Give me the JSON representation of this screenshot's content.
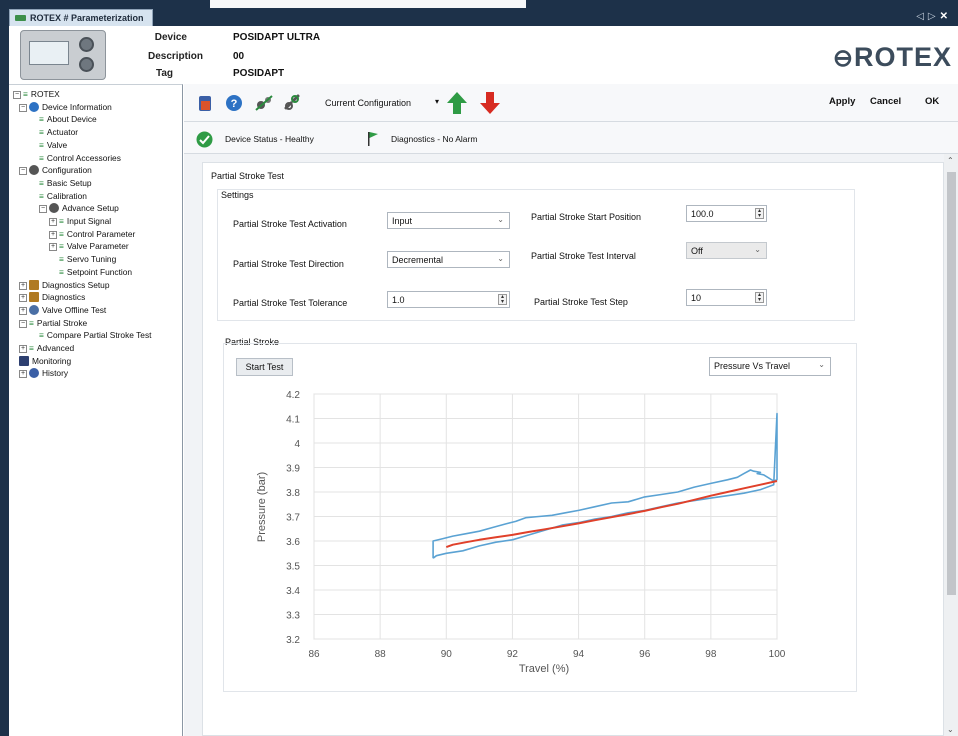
{
  "window": {
    "tab_title": "ROTEX # Parameterization",
    "controls": [
      "◁",
      "▷",
      "✕"
    ]
  },
  "header": {
    "device_label": "Device",
    "device_value": "POSIDAPT ULTRA",
    "description_label": "Description",
    "description_value": "00",
    "tag_label": "Tag",
    "tag_value": "POSIDAPT",
    "logo_text": "ROTEX"
  },
  "tree": [
    {
      "label": "ROTEX",
      "expander": "−",
      "icon": "eq"
    },
    {
      "label": "Device Information",
      "expander": "−",
      "icon": "info"
    },
    {
      "label": "About Device",
      "icon": "eq"
    },
    {
      "label": "Actuator",
      "icon": "eq"
    },
    {
      "label": "Valve",
      "icon": "eq"
    },
    {
      "label": "Control Accessories",
      "icon": "eq"
    },
    {
      "label": "Configuration",
      "expander": "−",
      "icon": "gear"
    },
    {
      "label": "Basic Setup",
      "icon": "eq"
    },
    {
      "label": "Calibration",
      "icon": "eq"
    },
    {
      "label": "Advance Setup",
      "expander": "−",
      "icon": "gear"
    },
    {
      "label": "Input Signal",
      "expander": "+",
      "icon": "eq"
    },
    {
      "label": "Control Parameter",
      "expander": "+",
      "icon": "eq"
    },
    {
      "label": "Valve Parameter",
      "expander": "+",
      "icon": "eq"
    },
    {
      "label": "Servo Tuning",
      "icon": "eq"
    },
    {
      "label": "Setpoint Function",
      "icon": "eq"
    },
    {
      "label": "Diagnostics Setup",
      "expander": "+",
      "icon": "bars"
    },
    {
      "label": "Diagnostics",
      "expander": "+",
      "icon": "bars"
    },
    {
      "label": "Valve Offline Test",
      "expander": "+",
      "icon": "clock"
    },
    {
      "label": "Partial Stroke",
      "expander": "−",
      "icon": "eq"
    },
    {
      "label": "Compare Partial Stroke Test",
      "icon": "eq"
    },
    {
      "label": "Advanced",
      "expander": "+",
      "icon": "eq"
    },
    {
      "label": "Monitoring",
      "icon": "screen"
    },
    {
      "label": "History",
      "expander": "+",
      "icon": "history"
    }
  ],
  "toolbar": {
    "config_select": "Current Configuration",
    "apply": "Apply",
    "cancel": "Cancel",
    "ok": "OK"
  },
  "status": {
    "device_status": "Device Status - Healthy",
    "diagnostics": "Diagnostics - No Alarm"
  },
  "partial_stroke_test": {
    "title": "Partial Stroke Test",
    "settings_title": "Settings",
    "activation_label": "Partial Stroke Test Activation",
    "activation_value": "Input",
    "direction_label": "Partial Stroke Test Direction",
    "direction_value": "Decremental",
    "tolerance_label": "Partial Stroke Test Tolerance",
    "tolerance_value": "1.0",
    "start_position_label": "Partial Stroke Start Position",
    "start_position_value": "100.0",
    "interval_label": "Partial Stroke Test Interval",
    "interval_value": "Off",
    "step_label": "Partial Stroke Test Step",
    "step_value": "10"
  },
  "partial_stroke": {
    "title": "Partial Stroke",
    "start_button": "Start Test",
    "plot_select": "Pressure Vs Travel"
  },
  "chart_data": {
    "type": "line",
    "title": "",
    "xlabel": "Travel (%)",
    "ylabel": "Pressure (bar)",
    "xlim": [
      86,
      100
    ],
    "ylim": [
      3.2,
      4.2
    ],
    "xticks": [
      "86",
      "88",
      "90",
      "92",
      "94",
      "96",
      "98",
      "100"
    ],
    "yticks": [
      "3.2",
      "3.3",
      "3.4",
      "3.5",
      "3.6",
      "3.7",
      "3.8",
      "3.9",
      "4",
      "4.1",
      "4.2"
    ],
    "grid": true,
    "legend": "none",
    "series": [
      {
        "color": "#5aa2d3",
        "x": [
          89.6,
          89.6,
          89.9,
          90.2,
          90.6,
          91.0,
          91.4,
          91.8,
          92.1,
          92.4,
          92.8,
          93.2,
          93.6,
          94.0,
          94.5,
          95.0,
          95.5,
          96.0,
          96.5,
          97.0,
          97.5,
          98.0,
          98.5,
          98.8,
          99.0,
          99.2,
          99.3,
          99.5,
          99.4,
          99.6,
          99.9,
          100.0,
          100.0,
          99.9,
          99.5,
          99.0,
          98.5,
          98.0,
          97.5,
          97.0,
          96.5,
          96.0,
          95.5,
          95.0,
          94.5,
          94.0,
          93.5,
          93.0,
          92.5,
          92.0,
          91.5,
          91.0,
          90.5,
          90.0,
          89.7,
          89.6
        ],
        "y": [
          3.53,
          3.6,
          3.61,
          3.62,
          3.63,
          3.64,
          3.655,
          3.67,
          3.68,
          3.695,
          3.7,
          3.705,
          3.715,
          3.725,
          3.74,
          3.755,
          3.76,
          3.78,
          3.79,
          3.8,
          3.82,
          3.835,
          3.85,
          3.86,
          3.875,
          3.89,
          3.885,
          3.88,
          3.875,
          3.87,
          3.845,
          3.85,
          4.12,
          3.83,
          3.81,
          3.795,
          3.785,
          3.775,
          3.765,
          3.755,
          3.74,
          3.725,
          3.715,
          3.7,
          3.69,
          3.675,
          3.665,
          3.645,
          3.625,
          3.605,
          3.595,
          3.58,
          3.56,
          3.55,
          3.54,
          3.53
        ]
      },
      {
        "color": "#e0402a",
        "x": [
          90.0,
          90.2,
          90.6,
          91.0,
          91.5,
          92.0,
          92.5,
          93.0,
          93.5,
          94.0,
          94.5,
          95.0,
          95.5,
          96.0,
          96.5,
          97.0,
          97.5,
          98.0,
          98.5,
          99.0,
          99.5,
          100.0
        ],
        "y": [
          3.575,
          3.585,
          3.595,
          3.605,
          3.615,
          3.625,
          3.637,
          3.648,
          3.66,
          3.672,
          3.685,
          3.697,
          3.71,
          3.723,
          3.738,
          3.752,
          3.768,
          3.785,
          3.8,
          3.815,
          3.83,
          3.845
        ]
      }
    ]
  }
}
